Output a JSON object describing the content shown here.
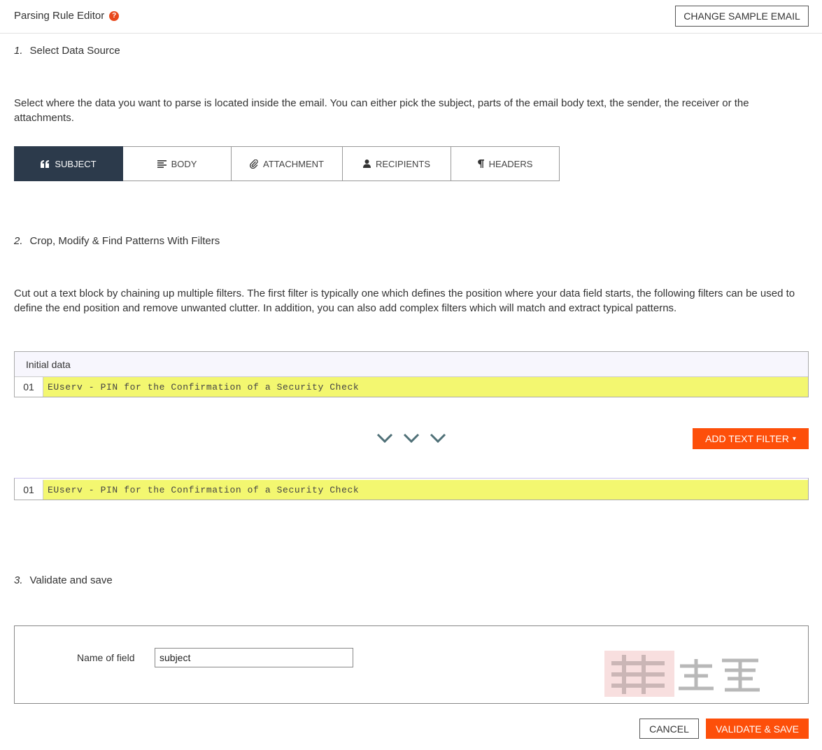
{
  "header": {
    "title": "Parsing Rule Editor",
    "help_glyph": "?",
    "change_sample_label": "CHANGE SAMPLE EMAIL"
  },
  "step1": {
    "number": "1.",
    "title": "Select Data Source",
    "description": "Select where the data you want to parse is located inside the email. You can either pick the subject, parts of the email body text, the sender, the receiver or the attachments."
  },
  "tabs": [
    {
      "label": "SUBJECT",
      "icon": "quote-icon",
      "active": true
    },
    {
      "label": "BODY",
      "icon": "align-left-icon",
      "active": false
    },
    {
      "label": "ATTACHMENT",
      "icon": "paperclip-icon",
      "active": false
    },
    {
      "label": "RECIPIENTS",
      "icon": "user-icon",
      "active": false
    },
    {
      "label": "HEADERS",
      "icon": "paragraph-icon",
      "active": false
    }
  ],
  "step2": {
    "number": "2.",
    "title": "Crop, Modify & Find Patterns With Filters",
    "description": "Cut out a text block by chaining up multiple filters. The first filter is typically one which defines the position where your data field starts, the following filters can be used to define the end position and remove unwanted clutter. In addition, you can also add complex filters which will match and extract typical patterns."
  },
  "initial_data": {
    "heading": "Initial data",
    "rows": [
      {
        "line": "01",
        "text": "EUserv - PIN for the Confirmation of a Security Check"
      }
    ]
  },
  "filter": {
    "add_label": "ADD TEXT FILTER",
    "caret": "▾"
  },
  "result_data": {
    "rows": [
      {
        "line": "01",
        "text": "EUserv - PIN for the Confirmation of a Security Check"
      }
    ]
  },
  "step3": {
    "number": "3.",
    "title": "Validate and save",
    "field_label": "Name of field",
    "field_value": "subject"
  },
  "actions": {
    "cancel_label": "CANCEL",
    "save_label": "VALIDATE & SAVE"
  },
  "colors": {
    "accent": "#fd4f0a",
    "tab_active": "#2c3a4b",
    "highlight": "#f3f770",
    "chevron": "#4f7077"
  }
}
